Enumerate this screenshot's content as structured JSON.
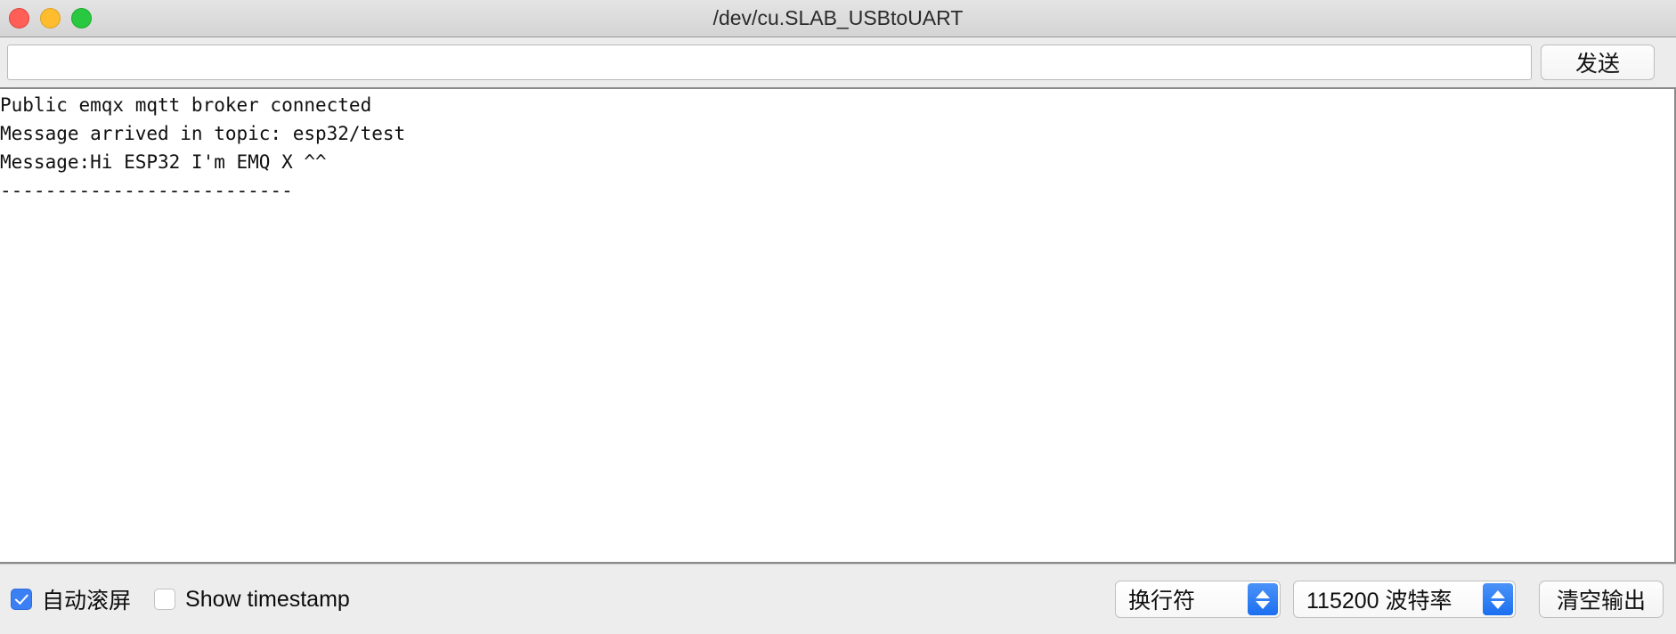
{
  "titlebar": {
    "title": "/dev/cu.SLAB_USBtoUART",
    "traffic_lights": [
      {
        "name": "close-button",
        "color": "#ff5f57"
      },
      {
        "name": "minimize-button",
        "color": "#febc2e"
      },
      {
        "name": "maximize-button",
        "color": "#28c840"
      }
    ]
  },
  "sendbar": {
    "input_value": "",
    "input_placeholder": "",
    "send_label": "发送"
  },
  "console": {
    "lines": [
      "Public emqx mqtt broker connected",
      "Message arrived in topic: esp32/test",
      "Message:Hi ESP32 I'm EMQ X ^^",
      "--------------------------"
    ],
    "text": "Public emqx mqtt broker connected\nMessage arrived in topic: esp32/test\nMessage:Hi ESP32 I'm EMQ X ^^\n--------------------------"
  },
  "bottombar": {
    "autoscroll": {
      "label": "自动滚屏",
      "checked": true
    },
    "show_timestamp": {
      "label": "Show timestamp",
      "checked": false
    },
    "line_ending_select": {
      "value": "换行符"
    },
    "baud_select": {
      "value": "115200 波特率"
    },
    "clear_label": "清空输出"
  },
  "colors": {
    "accent_blue": "#3b7ff5",
    "stepper_blue": "#1b6ff0",
    "toolbar_bg": "#ededed",
    "titlebar_bg": "#d9d9d9",
    "console_bg": "#ffffff",
    "console_text": "#101010"
  }
}
